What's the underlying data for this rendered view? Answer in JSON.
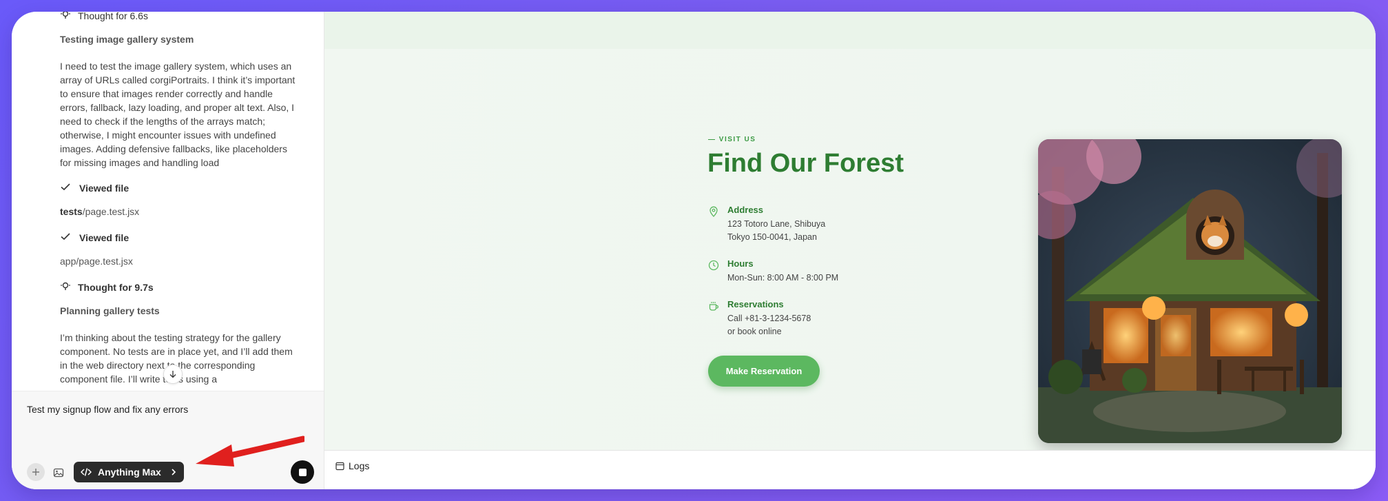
{
  "chat": {
    "thought1": "Thought for 6.6s",
    "heading1": "Testing image gallery system",
    "para1": "I need to test the image gallery system, which uses an array of URLs called corgiPortraits. I think it’s important to ensure that images render correctly and handle errors, fallback, lazy loading, and proper alt text. Also, I need to check if the lengths of the arrays match; otherwise, I might encounter issues with undefined images. Adding defensive fallbacks, like placeholders for missing images and handling load",
    "viewed1": "Viewed file",
    "path1_dir": "tests",
    "path1_file": "/page.test.jsx",
    "viewed2": "Viewed file",
    "path2": "app/page.test.jsx",
    "thought2": "Thought for 9.7s",
    "heading2": "Planning gallery tests",
    "para2": "I’m thinking about the testing strategy for the gallery component. No tests are in place yet, and I’ll add them in the web directory next to the corresponding component file. I’ll write tests using a"
  },
  "composer": {
    "text": "Test my signup flow and fix any errors",
    "model_label": "Anything Max"
  },
  "preview": {
    "eyebrow": "— VISIT US",
    "title": "Find Our Forest",
    "address_label": "Address",
    "address_line1": "123 Totoro Lane, Shibuya",
    "address_line2": "Tokyo 150-0041, Japan",
    "hours_label": "Hours",
    "hours_line1": "Mon-Sun: 8:00 AM - 8:00 PM",
    "reservations_label": "Reservations",
    "reservations_line1": "Call +81-3-1234-5678",
    "reservations_line2": "or book online",
    "button": "Make Reservation",
    "accent_color": "#2e7d32"
  },
  "logs": {
    "label": "Logs"
  }
}
